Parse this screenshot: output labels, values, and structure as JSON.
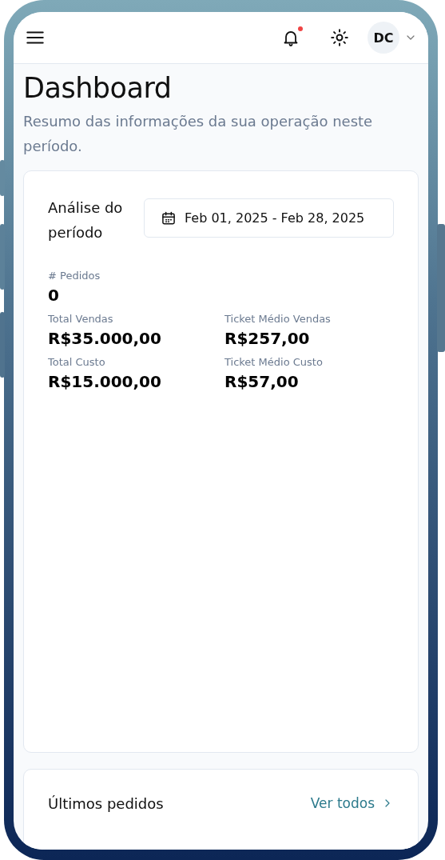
{
  "header": {
    "notifications": {
      "unread": true
    },
    "avatar": {
      "initials": "DC"
    }
  },
  "page": {
    "title": "Dashboard",
    "subtitle": "Resumo das informações da sua operação neste período."
  },
  "summary": {
    "label": "Análise do período",
    "date_range": "Feb 01, 2025 - Feb 28, 2025",
    "metrics": [
      {
        "label": "# Pedidos",
        "value": "0"
      },
      {
        "label": "Total Vendas",
        "value": "R$35.000,00"
      },
      {
        "label": "Ticket Médio Vendas",
        "value": "R$257,00"
      },
      {
        "label": "Total Custo",
        "value": "R$15.000,00"
      },
      {
        "label": "Ticket Médio Custo",
        "value": "R$57,00"
      }
    ]
  },
  "recent_orders": {
    "title": "Últimos pedidos",
    "link": "Ver todos"
  }
}
